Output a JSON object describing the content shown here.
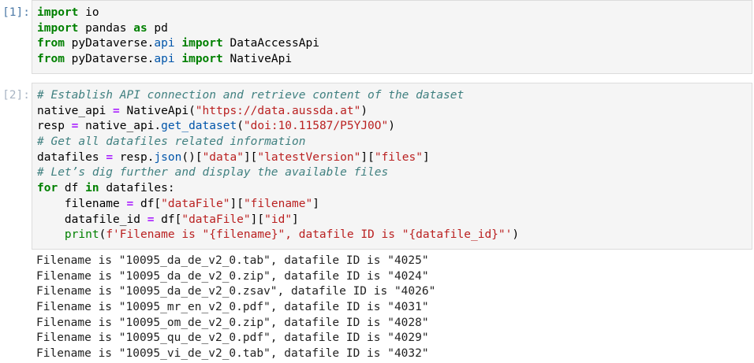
{
  "cell1": {
    "prompt": "[1]:",
    "line1": {
      "kw": "import",
      "rest": " io"
    },
    "line2": {
      "kw1": "import",
      "mid": " pandas ",
      "kw2": "as",
      "rest": " pd"
    },
    "line3": {
      "kw1": "from",
      "mod": " pyDataverse.",
      "sub": "api",
      "sp": " ",
      "kw2": "import",
      "rest": " DataAccessApi"
    },
    "line4": {
      "kw1": "from",
      "mod": " pyDataverse.",
      "sub": "api",
      "sp": " ",
      "kw2": "import",
      "rest": " NativeApi"
    }
  },
  "cell2": {
    "prompt": "[2]:",
    "c1": "# Establish API connection and retrieve content of the dataset",
    "l2": {
      "a": "native_api ",
      "op": "=",
      "b": " NativeApi(",
      "s": "\"https://data.aussda.at\"",
      "c": ")"
    },
    "l3": {
      "a": "resp ",
      "op": "=",
      "b": " native_api.",
      "fn": "get_dataset",
      "c": "(",
      "s": "\"doi:10.11587/P5YJ0O\"",
      "d": ")"
    },
    "c4": "# Get all datafiles related information",
    "l5": {
      "a": "datafiles ",
      "op": "=",
      "b": " resp.",
      "fn": "json",
      "c": "()[",
      "s1": "\"data\"",
      "d": "][",
      "s2": "\"latestVersion\"",
      "e": "][",
      "s3": "\"files\"",
      "f": "]"
    },
    "c6": "# Let’s dig further and display the available files",
    "l7": {
      "kw1": "for",
      "a": " df ",
      "kw2": "in",
      "b": " datafiles:"
    },
    "l8": {
      "a": "    filename ",
      "op": "=",
      "b": " df[",
      "s1": "\"dataFile\"",
      "c": "][",
      "s2": "\"filename\"",
      "d": "]"
    },
    "l9": {
      "a": "    datafile_id ",
      "op": "=",
      "b": " df[",
      "s1": "\"dataFile\"",
      "c": "][",
      "s2": "\"id\"",
      "d": "]"
    },
    "l10": {
      "a": "    ",
      "fn": "print",
      "b": "(",
      "s": "f'Filename is \"{filename}\", datafile ID is \"{datafile_id}\"'",
      "c": ")"
    }
  },
  "output": {
    "lines": [
      "Filename is \"10095_da_de_v2_0.tab\", datafile ID is \"4025\"",
      "Filename is \"10095_da_de_v2_0.zip\", datafile ID is \"4024\"",
      "Filename is \"10095_da_de_v2_0.zsav\", datafile ID is \"4026\"",
      "Filename is \"10095_mr_en_v2_0.pdf\", datafile ID is \"4031\"",
      "Filename is \"10095_om_de_v2_0.zip\", datafile ID is \"4028\"",
      "Filename is \"10095_qu_de_v2_0.pdf\", datafile ID is \"4029\"",
      "Filename is \"10095_vi_de_v2_0.tab\", datafile ID is \"4032\""
    ]
  }
}
